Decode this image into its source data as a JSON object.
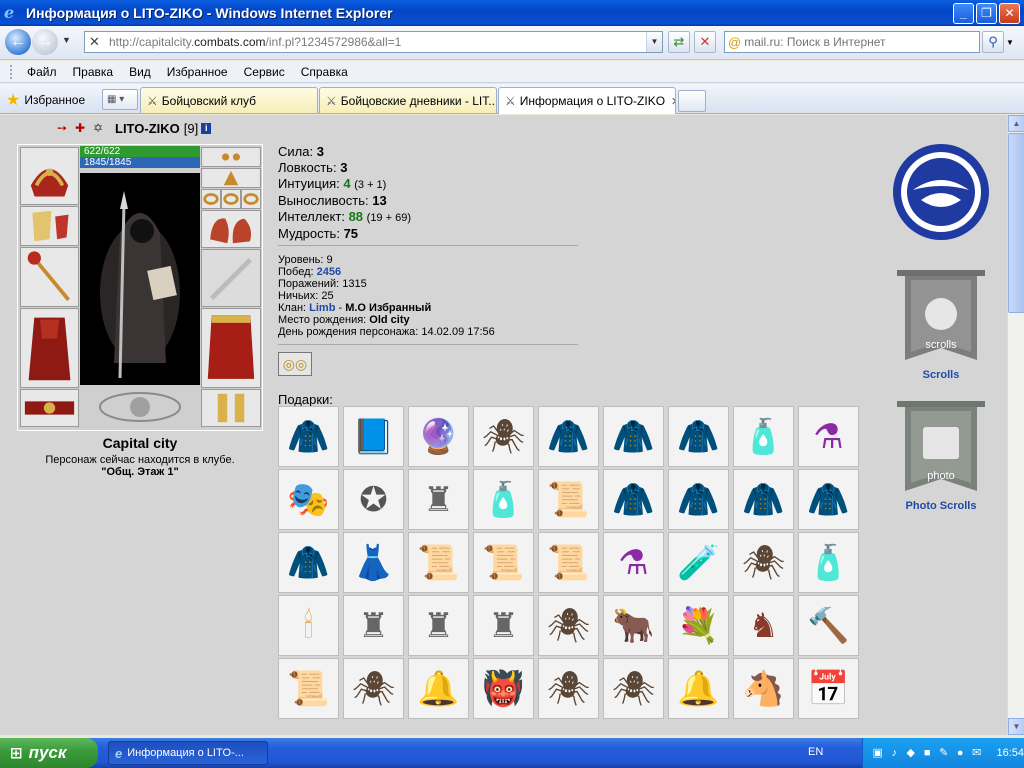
{
  "window": {
    "title": "Информация о LITO-ZIKO - Windows Internet Explorer"
  },
  "address": {
    "url_prefix": "http://capitalcity.",
    "url_domain": "combats.com",
    "url_rest": "/inf.pl?1234572986&all=1",
    "search_placeholder": "mail.ru: Поиск в Интернет"
  },
  "menu": {
    "items": [
      "Файл",
      "Правка",
      "Вид",
      "Избранное",
      "Сервис",
      "Справка"
    ]
  },
  "favorites": {
    "label": "Избранное"
  },
  "tabs": [
    {
      "label": "Бойцовский клуб",
      "active": false
    },
    {
      "label": "Бойцовские дневники - LIT...",
      "active": false
    },
    {
      "label": "Информация о LITO-ZIKO",
      "active": true
    }
  ],
  "character": {
    "nick": "LITO-ZIKO",
    "level": "[9]",
    "hp": "622/622",
    "mana": "1845/1845",
    "city": "Capital city",
    "location_note": "Персонаж сейчас находится в клубе.",
    "room": "\"Общ. Этаж 1\""
  },
  "stats": [
    {
      "label": "Сила:",
      "value": "3",
      "extra": ""
    },
    {
      "label": "Ловкость:",
      "value": "3",
      "extra": ""
    },
    {
      "label": "Интуиция:",
      "value": "4",
      "extra": "(3 + 1)"
    },
    {
      "label": "Выносливость:",
      "value": "13",
      "extra": ""
    },
    {
      "label": "Интеллект:",
      "value": "88",
      "extra": "(19 + 69)"
    },
    {
      "label": "Мудрость:",
      "value": "75",
      "extra": ""
    }
  ],
  "info": {
    "level_label": "Уровень:",
    "level_value": "9",
    "wins_label": "Побед:",
    "wins_value": "2456",
    "losses_label": "Поражений:",
    "losses_value": "1315",
    "draws_label": "Ничьих:",
    "draws_value": "25",
    "clan_label": "Клан:",
    "clan_link": "Limb",
    "clan_sep": " - ",
    "clan_rank": "М.О Избранный",
    "birthplace_label": "Место рождения:",
    "birthplace_value": "Old city",
    "birthday_label": "День рождения персонажа:",
    "birthday_value": "14.02.09 17:56"
  },
  "gifts": {
    "label": "Подарки:",
    "items": [
      "cape-red",
      "spellbook-icon",
      "crystal-ball-icon",
      "spider-icon",
      "cape-red",
      "cape-red",
      "cape-grey",
      "vaseline-icon",
      "potions-icon",
      "jester-hat-icon",
      "medal-icon",
      "statue-icon",
      "vaseline-icon",
      "scroll-icon",
      "cape-green",
      "cape-grey",
      "cape-red",
      "cape-red",
      "cape-red",
      "dress-icon",
      "scroll-icon",
      "scroll-icon",
      "scroll-icon",
      "potions-icon",
      "bottle-icon",
      "spider-icon",
      "vaseline-icon",
      "candle-icon",
      "statue-icon",
      "statue-icon",
      "statue-icon",
      "spider-icon",
      "bull-icon",
      "bouquet-icon",
      "knight-icon",
      "mace-icon",
      "scroll-icon",
      "spider-icon",
      "bell-icon",
      "goblin-icon",
      "spider-icon",
      "spider-icon",
      "bell-icon",
      "horse-icon",
      "calendar-icon"
    ]
  },
  "sidebar": {
    "scrolls_label": "Scrolls",
    "scrolls_banner_text": "scrolls",
    "photo_label": "Photo Scrolls",
    "photo_banner_text": "photo"
  },
  "taskbar": {
    "start_label": "пуск",
    "item_label": "Информация о LITO-...",
    "lang": "EN",
    "clock": "16:54"
  },
  "colors": {
    "link": "#1f4aa8",
    "green_stat": "#157815",
    "page_bg": "#d5d5d5"
  }
}
